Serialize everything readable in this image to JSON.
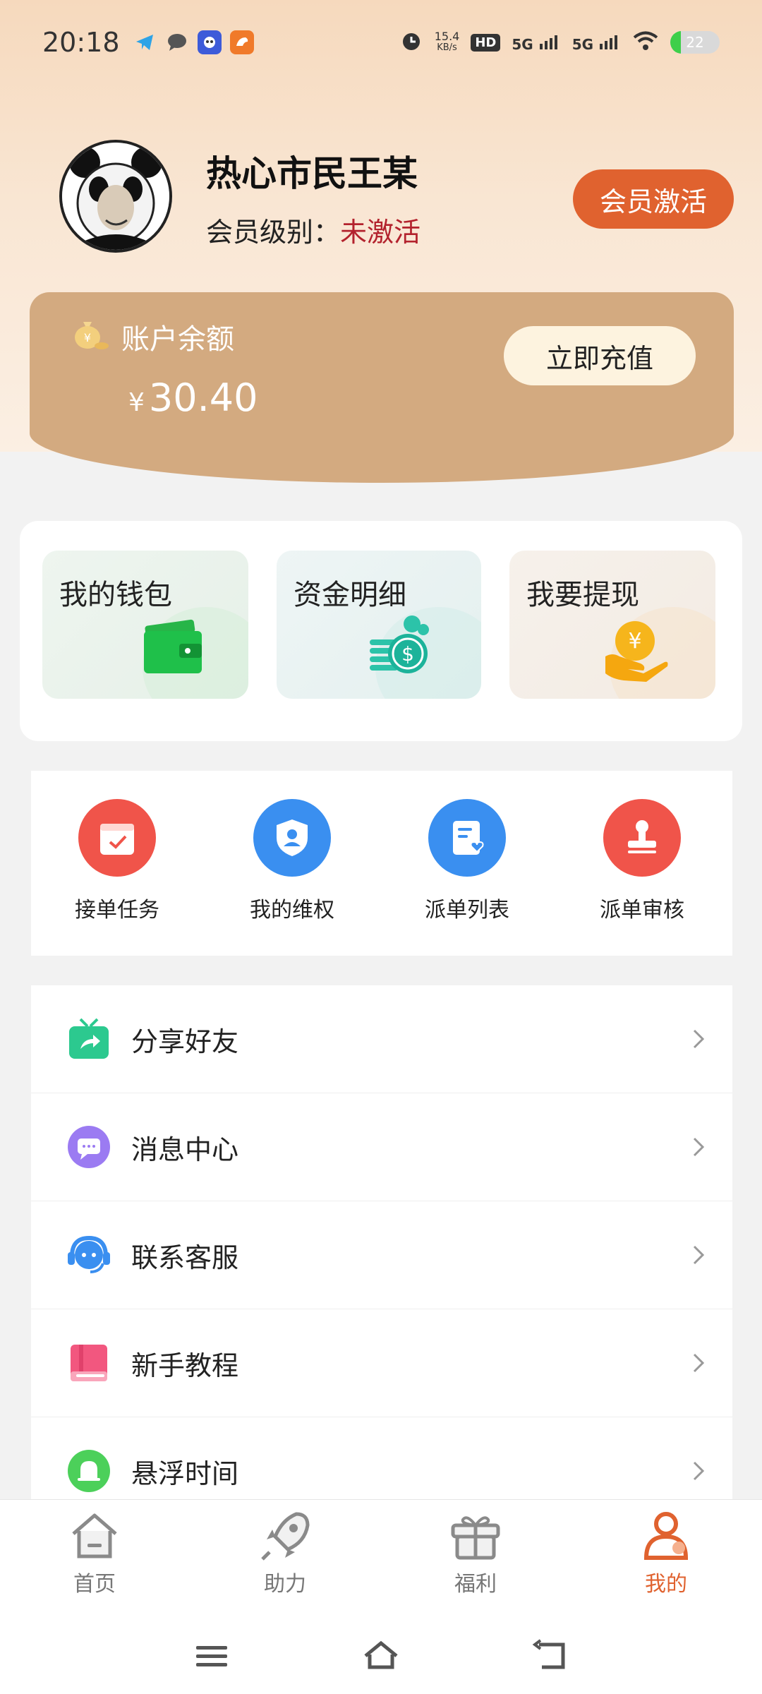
{
  "status_bar": {
    "time": "20:18",
    "net_speed_value": "15.4",
    "net_speed_unit": "KB/s",
    "hd_label": "HD",
    "sim1": "5G",
    "sim2": "5G",
    "battery": "22"
  },
  "profile": {
    "name": "热心市民王某",
    "level_label": "会员级别：",
    "level_status": "未激活",
    "activate_label": "会员激活"
  },
  "balance": {
    "label": "账户余额",
    "currency": "¥",
    "amount": "30.40",
    "recharge_label": "立即充值"
  },
  "wallet_cards": [
    {
      "label": "我的钱包",
      "icon": "wallet-icon"
    },
    {
      "label": "资金明细",
      "icon": "coins-icon"
    },
    {
      "label": "我要提现",
      "icon": "withdraw-icon"
    }
  ],
  "tasks": [
    {
      "label": "接单任务",
      "icon": "calendar-check-icon",
      "color": "#f0544a"
    },
    {
      "label": "我的维权",
      "icon": "shield-user-icon",
      "color": "#3a8ff0"
    },
    {
      "label": "派单列表",
      "icon": "document-heart-icon",
      "color": "#3a8ff0"
    },
    {
      "label": "派单审核",
      "icon": "stamp-icon",
      "color": "#f0544a"
    }
  ],
  "menu": [
    {
      "label": "分享好友",
      "icon": "share-gift-icon",
      "color": "#2cc98f"
    },
    {
      "label": "消息中心",
      "icon": "message-icon",
      "color": "#9b7bf2"
    },
    {
      "label": "联系客服",
      "icon": "headset-icon",
      "color": "#3a8ff0"
    },
    {
      "label": "新手教程",
      "icon": "book-icon",
      "color": "#f2577f"
    },
    {
      "label": "悬浮时间",
      "icon": "bell-icon",
      "color": "#4cd05a"
    }
  ],
  "bottom_nav": [
    {
      "label": "首页",
      "icon": "home-icon"
    },
    {
      "label": "助力",
      "icon": "rocket-icon"
    },
    {
      "label": "福利",
      "icon": "gift-icon"
    },
    {
      "label": "我的",
      "icon": "user-icon",
      "active": true
    }
  ],
  "colors": {
    "accent": "#e0622f",
    "balance_card": "#d3aa80",
    "inactive_status": "#b3222d"
  }
}
